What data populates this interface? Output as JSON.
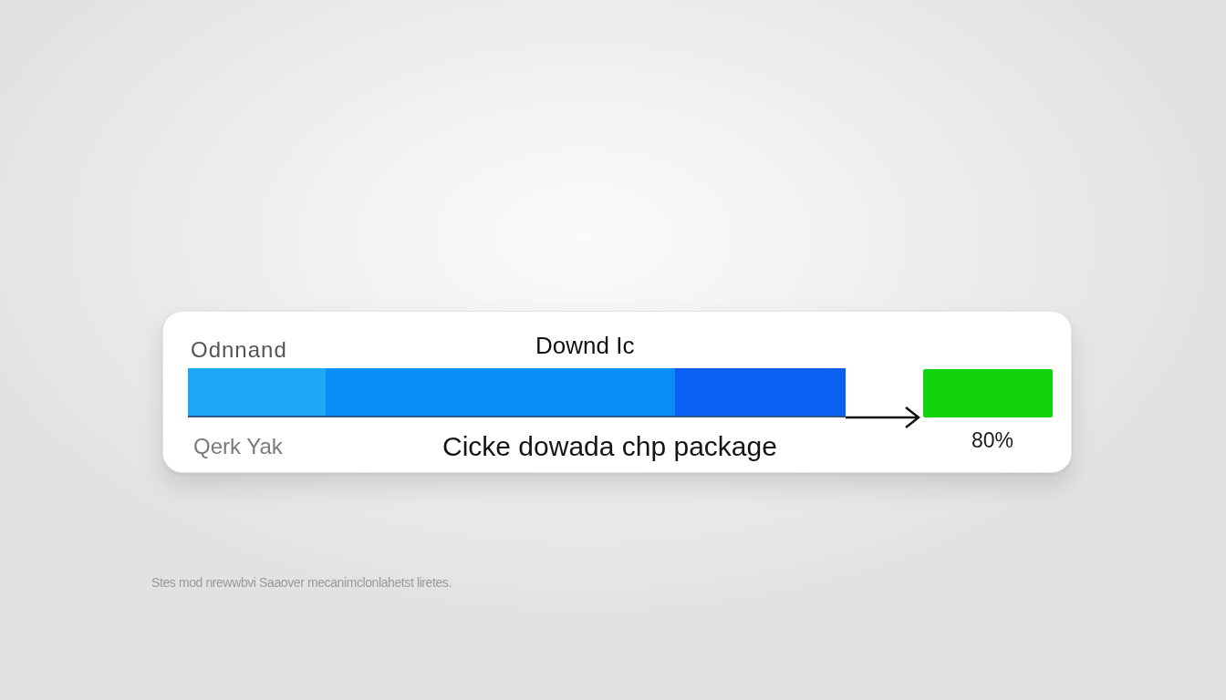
{
  "dialog": {
    "label": "Odnnand",
    "title": "Downd Ic",
    "progress": {
      "segments": [
        {
          "color": "#1ea8f6",
          "level": 0.21
        },
        {
          "color": "#0a8df6",
          "level": 0.74
        },
        {
          "color": "#0a60f0",
          "level": 1
        }
      ]
    },
    "reading": "80%",
    "secondary_label": "Qerk Yak",
    "message": "Cicke dowada chp package"
  },
  "footer_note": "Stes mod nrewwbvi Saaover mecanimclonlahetst liretes."
}
